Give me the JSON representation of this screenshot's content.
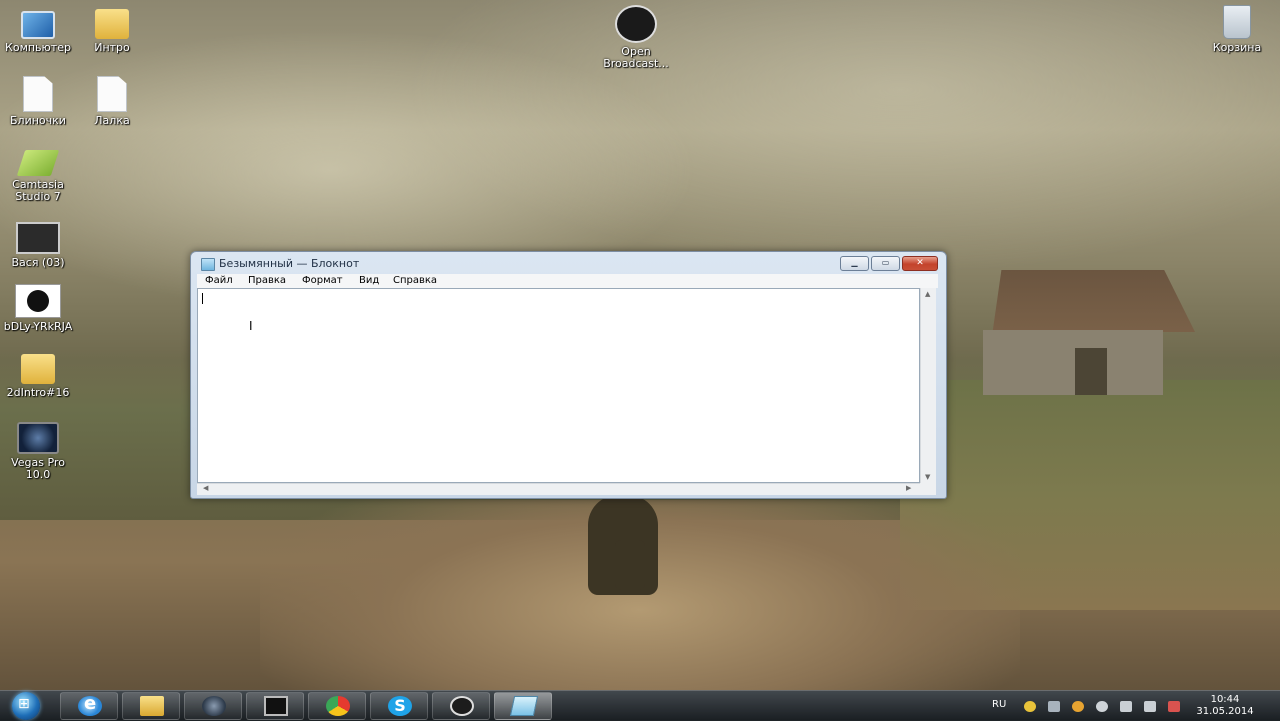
{
  "desktop": {
    "icons": [
      {
        "label": "Компьютер"
      },
      {
        "label": "Интро"
      },
      {
        "label": "Блиночки"
      },
      {
        "label": "Лалка"
      },
      {
        "label": "Camtasia Studio 7"
      },
      {
        "label": "Вася (03)"
      },
      {
        "label": "bDLy-YRkRJA"
      },
      {
        "label": "2dIntro#16"
      },
      {
        "label": "Vegas Pro 10.0"
      },
      {
        "label": "Open Broadcast..."
      },
      {
        "label": "Корзина"
      }
    ]
  },
  "notepad": {
    "title": "Безымянный — Блокнот",
    "menu": [
      "Файл",
      "Правка",
      "Формат",
      "Вид",
      "Справка"
    ],
    "text": ""
  },
  "taskbar": {
    "apps": [
      "internet-explorer",
      "file-explorer",
      "steam",
      "monitor-app",
      "chrome",
      "skype",
      "obs",
      "notepad"
    ],
    "active_app": "notepad",
    "language": "RU",
    "time": "10:44",
    "date": "31.05.2014"
  },
  "colors": {
    "titlebar": "#c8d6e6",
    "close_button": "#c4432c",
    "taskbar": "#1a2026"
  }
}
